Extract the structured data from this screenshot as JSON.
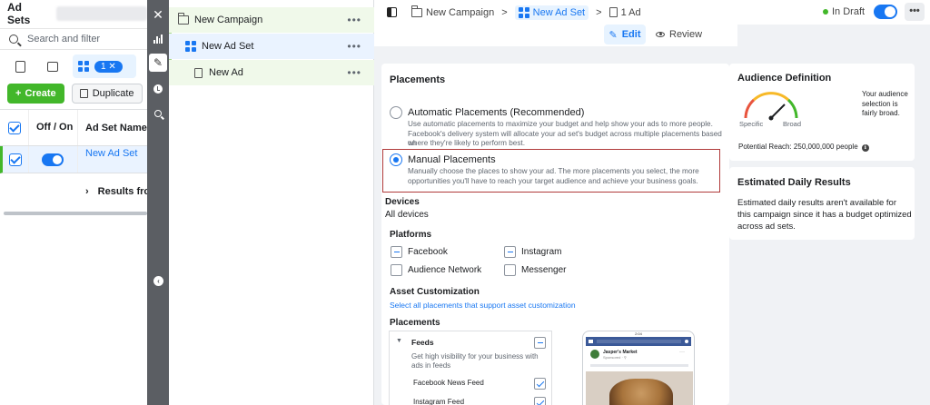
{
  "adsets_panel": {
    "title": "Ad Sets",
    "search_placeholder": "Search and filter",
    "selected_count_badge": "1 ✕",
    "create_label": "Create",
    "duplicate_label": "Duplicate",
    "columns": {
      "off_on": "Off / On",
      "name": "Ad Set Name"
    },
    "row": {
      "name": "New Ad Set",
      "enabled": true
    },
    "results_label": "Results from"
  },
  "tree": {
    "campaign": "New Campaign",
    "adset": "New Ad Set",
    "ad": "New Ad",
    "more": "•••"
  },
  "topbar": {
    "breadcrumb": [
      "New Campaign",
      "New Ad Set",
      "1 Ad"
    ],
    "separator": ">",
    "status": "In Draft",
    "more": "•••"
  },
  "subbar": {
    "edit_label": "Edit",
    "review_label": "Review"
  },
  "placements": {
    "title": "Placements",
    "automatic": {
      "label": "Automatic Placements (Recommended)",
      "desc1": "Use automatic placements to maximize your budget and help show your ads to more people.",
      "desc2": "Facebook's delivery system will allocate your ad set's budget across multiple placements based on",
      "desc3": "where they're likely to perform best."
    },
    "manual": {
      "label": "Manual Placements",
      "desc1": "Manually choose the places to show your ad. The more placements you select, the more",
      "desc2": "opportunities you'll have to reach your target audience and achieve your business goals."
    },
    "devices_label": "Devices",
    "devices_value": "All devices",
    "platforms_label": "Platforms",
    "platforms": [
      "Facebook",
      "Instagram",
      "Audience Network",
      "Messenger"
    ],
    "asset_label": "Asset Customization",
    "asset_link": "Select all placements that support asset customization",
    "placements_sub": "Placements",
    "feeds": {
      "title": "Feeds",
      "desc1": "Get high visibility for your business with",
      "desc2": "ads in feeds",
      "items": [
        "Facebook News Feed",
        "Instagram Feed"
      ]
    },
    "preview": {
      "time": "2:04",
      "page_name": "Jasper's Market",
      "sponsored": "Sponsored · ⚲"
    }
  },
  "audience": {
    "title": "Audience Definition",
    "note": "Your audience selection is fairly broad.",
    "specific": "Specific",
    "broad": "Broad",
    "reach": "Potential Reach: 250,000,000 people",
    "info_icon": "ℹ"
  },
  "estimate": {
    "title": "Estimated Daily Results",
    "text": "Estimated daily results aren't available for this campaign since it has a budget optimized across ad sets."
  }
}
